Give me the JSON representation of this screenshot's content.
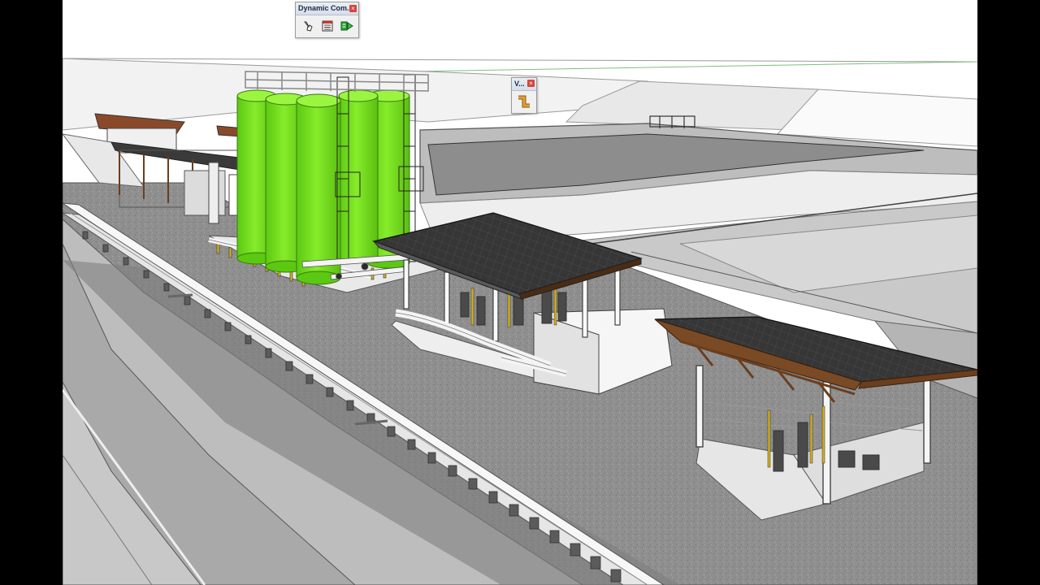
{
  "toolbars": {
    "dynamic_components": {
      "title": "Dynamic Com...",
      "close_glyph": "×",
      "buttons": [
        {
          "name": "interact",
          "icon": "interact-hand-icon"
        },
        {
          "name": "component-options",
          "icon": "component-options-icon"
        },
        {
          "name": "component-attributes",
          "icon": "component-attributes-icon"
        }
      ]
    },
    "v_toolbar": {
      "title": "V...",
      "close_glyph": "×",
      "buttons": [
        {
          "name": "pipe-tool",
          "icon": "pipe-icon"
        }
      ]
    }
  },
  "colors": {
    "viewport_background": "#ffffff",
    "letterbox": "#000000",
    "silo_green": "#7be21f",
    "gravel": "#8f8f8f",
    "roof": "#353535",
    "timber": "#7a4a24",
    "pipe_white": "#f4f4f4",
    "valve_yellow": "#d4b020",
    "toolbar_close": "#d9443a"
  }
}
